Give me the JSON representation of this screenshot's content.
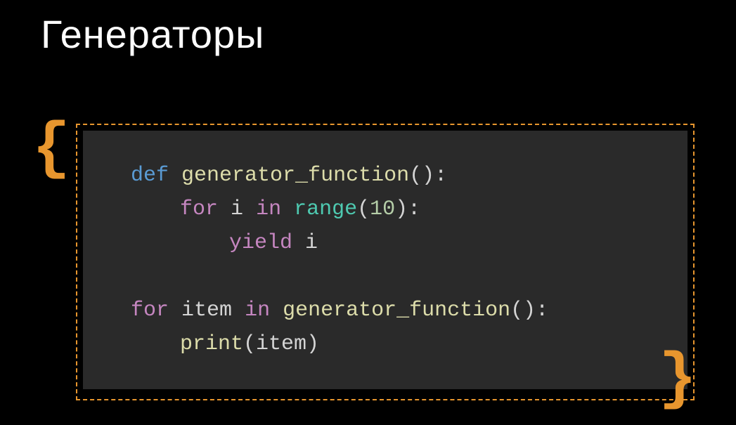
{
  "title": "Генераторы",
  "braces": {
    "open": "{",
    "close": "}"
  },
  "code": {
    "line1": {
      "def": "def",
      "name": "generator_function",
      "parens": "():"
    },
    "line2": {
      "for": "for",
      "var": "i",
      "in": "in",
      "range": "range",
      "open": "(",
      "num": "10",
      "close": "):"
    },
    "line3": {
      "yield": "yield",
      "var": "i"
    },
    "line4": {
      "for": "for",
      "var": "item",
      "in": "in",
      "fn": "generator_function",
      "parens": "():"
    },
    "line5": {
      "print": "print",
      "open": "(",
      "var": "item",
      "close": ")"
    }
  }
}
